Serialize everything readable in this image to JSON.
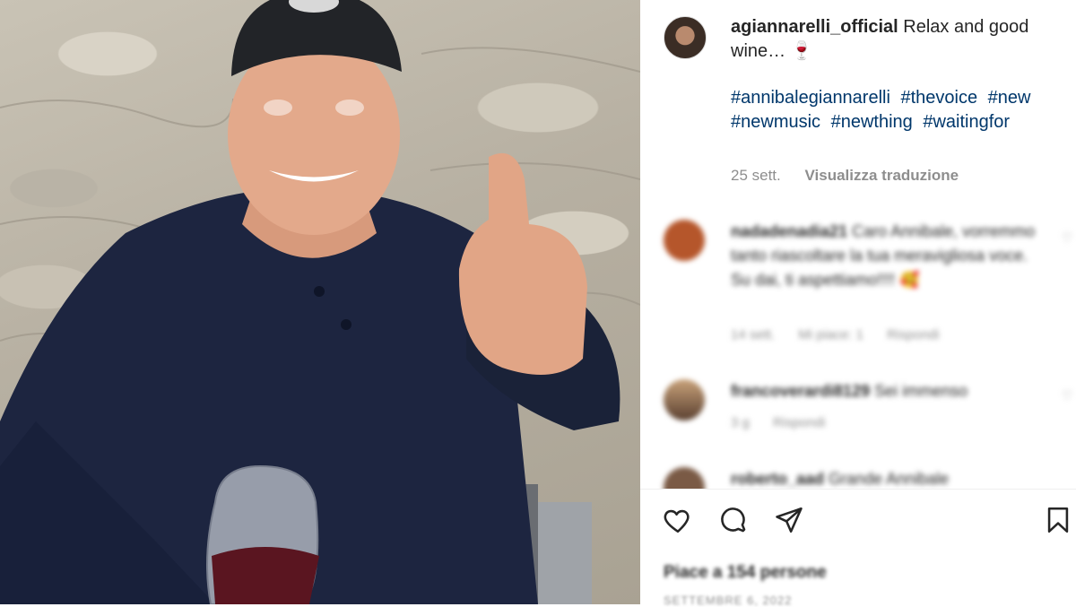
{
  "post": {
    "username": "agiannarelli_official",
    "caption": "Relax and good wine… 🍷",
    "hashtags": [
      "#annibalegiannarelli",
      "#thevoice",
      "#new",
      "#newmusic",
      "#newthing",
      "#waitingfor"
    ],
    "time": "25 sett.",
    "translate_label": "Visualizza traduzione"
  },
  "comments": [
    {
      "username": "nadadenadia21",
      "text": "Caro Annibale, vorremmo tanto riascoltare la tua meravigliosa voce. Su dai, ti aspettiamo!!!! 🥰",
      "time": "14 sett.",
      "likes": "Mi piace: 1",
      "reply": "Rispondi",
      "avatar_color": "#b5562b"
    },
    {
      "username": "francoverardi8129",
      "text": "Sei immenso",
      "time": "3 g",
      "reply": "Rispondi",
      "avatar_color": "#8a6b4a"
    },
    {
      "username": "roberto_aad",
      "text": "Grande Annibale",
      "avatar_color": "#7a5a45"
    }
  ],
  "actions": {
    "like_icon": "heart-icon",
    "comment_icon": "comment-icon",
    "share_icon": "share-icon",
    "save_icon": "bookmark-icon"
  },
  "likes_text": "Piace a 154 persone",
  "date_text": "SETTEMBRE 6, 2022"
}
